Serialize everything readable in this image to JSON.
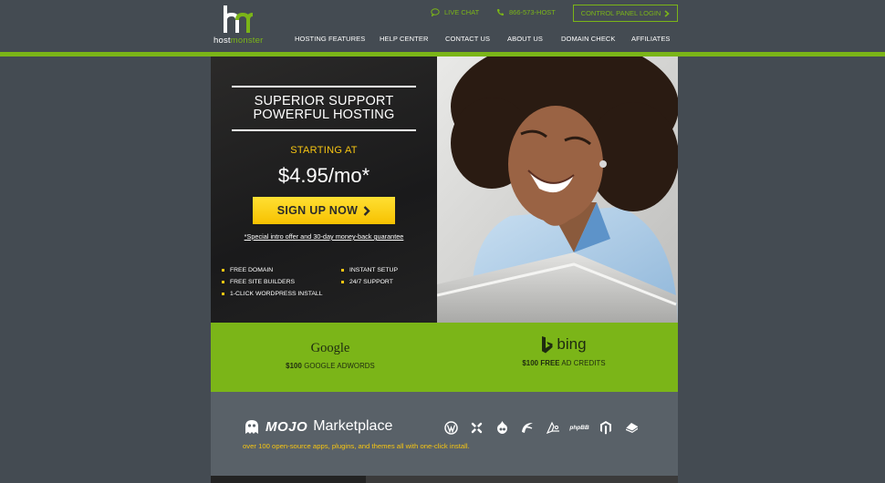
{
  "brand": {
    "logo_text_host": "host",
    "logo_text_monster": "monster",
    "accent": "#7bb518",
    "yellow": "#f6c512"
  },
  "utility": {
    "live_chat": "LIVE CHAT",
    "phone": "866-573-HOST",
    "control_panel": "CONTROL PANEL LOGIN"
  },
  "nav": {
    "items": [
      {
        "label": "HOSTING FEATURES"
      },
      {
        "label": "HELP CENTER"
      },
      {
        "label": "CONTACT US"
      },
      {
        "label": "ABOUT US"
      },
      {
        "label": "DOMAIN CHECK"
      },
      {
        "label": "AFFILIATES"
      }
    ]
  },
  "hero": {
    "headline_1": "SUPERIOR SUPPORT",
    "headline_2": "POWERFUL HOSTING",
    "starting_at": "STARTING AT",
    "price": "$4.95/mo*",
    "signup": "SIGN UP NOW",
    "disclaimer": "*Special intro offer and 30-day money-back guarantee",
    "features": [
      "FREE DOMAIN",
      "INSTANT SETUP",
      "FREE SITE BUILDERS",
      "24/7 SUPPORT",
      "1-CLICK WORDPRESS INSTALL"
    ]
  },
  "promos": {
    "google_logo": "Google",
    "google_amount": "$100",
    "google_text": "GOOGLE ADWORDS",
    "bing_logo": "bing",
    "bing_amount": "$100 FREE",
    "bing_text": "AD CREDITS"
  },
  "mojo": {
    "brand": "MOJO",
    "marketplace": "Marketplace",
    "subtitle": "over 100 open-source apps, plugins, and themes all with one-click install.",
    "apps": [
      "wordpress-icon",
      "joomla-icon",
      "drupal-icon",
      "app-icon-4",
      "app-icon-5",
      "phpbb-icon",
      "magento-icon",
      "app-icon-8"
    ],
    "phpbb_label": "phpBB"
  }
}
